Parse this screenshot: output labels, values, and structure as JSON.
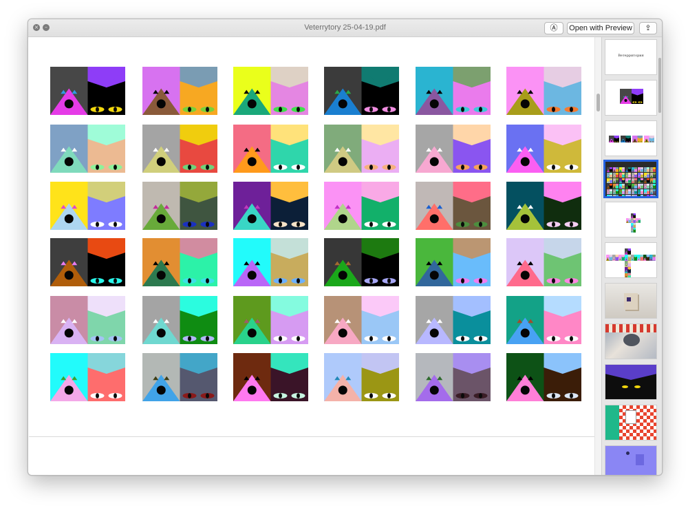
{
  "window": {
    "title": "Veterrytory 25-04-19.pdf",
    "buttons": {
      "markup_label": "Ⓐ",
      "open_with_preview": "Open with Preview",
      "share_label": "⇪"
    },
    "close_glyph": "×",
    "minimize_glyph": "–"
  },
  "sidebar": {
    "cover_text": "Ветерритория",
    "selected_index": 3
  },
  "tiles": [
    [
      "#474747",
      "#8e3df7",
      "#2f9be3",
      "#e53be7",
      "#000000",
      "#f2d70d"
    ],
    [
      "#d772f0",
      "#7a9cb3",
      "#000000",
      "#8a5a3a",
      "#f7a822",
      "#78d13a"
    ],
    [
      "#eaff1b",
      "#ded1c5",
      "#000000",
      "#1aa87a",
      "#e486e2",
      "#3fe04a"
    ],
    [
      "#3b3b3b",
      "#107b71",
      "#2aa94b",
      "#1a7fd0",
      "#000000",
      "#f08ce0"
    ],
    [
      "#2ab4d1",
      "#7ca06f",
      "#000000",
      "#8a57a0",
      "#ea7bec",
      "#3ecbd8"
    ],
    [
      "#fb92f5",
      "#e6cde3",
      "#000000",
      "#a89d1a",
      "#6cb7e1",
      "#f47a2f"
    ],
    [
      "#7fa1c5",
      "#9ffcd8",
      "#ffffff",
      "#7fdabc",
      "#ecba92",
      "#8ef29a"
    ],
    [
      "#a4a4a4",
      "#f0cd0e",
      "#ffffff",
      "#d0cf7c",
      "#e84940",
      "#6fd27a"
    ],
    [
      "#f46c84",
      "#ffe27a",
      "#000000",
      "#ff9a1c",
      "#2fd6ab",
      "#ffffff"
    ],
    [
      "#80ab7b",
      "#ffe6a3",
      "#ffffff",
      "#d0ca83",
      "#ebaef3",
      "#f6b07d"
    ],
    [
      "#a6a6a6",
      "#ffd6a9",
      "#ffffff",
      "#f7a8d1",
      "#8a55f0",
      "#f6a25a"
    ],
    [
      "#6a71f2",
      "#fbc1f5",
      "#ffffff",
      "#fb5ff2",
      "#cfb93a",
      "#ffffff"
    ],
    [
      "#ffe31a",
      "#d2cf7a",
      "#e34cc4",
      "#add6f0",
      "#7e7cff",
      "#ffffff"
    ],
    [
      "#bfb9b0",
      "#94a83b",
      "#c32a9a",
      "#68aa3a",
      "#3f5540",
      "#1a30c0"
    ],
    [
      "#6e2099",
      "#ffbe3d",
      "#c238bd",
      "#39d6c5",
      "#0c1f38",
      "#f6e2c8"
    ],
    [
      "#fb92f5",
      "#f9a9e6",
      "#c22ec6",
      "#b0d58b",
      "#12b06a",
      "#ffffff"
    ],
    [
      "#c0b8b6",
      "#ff6d88",
      "#1a5fd0",
      "#ff6f6a",
      "#6b563e",
      "#4c8e3e"
    ],
    [
      "#045060",
      "#ff82f0",
      "#ffffff",
      "#a5c23a",
      "#102d0e",
      "#f4cef2"
    ],
    [
      "#3e3e3e",
      "#e84a12",
      "#e87bf0",
      "#b05d0a",
      "#000000",
      "#29f6ea"
    ],
    [
      "#e28e32",
      "#d18ca0",
      "#000000",
      "#2c7a4f",
      "#2cf2a8",
      "#3edfe8"
    ],
    [
      "#22fbfb",
      "#c4e0d8",
      "#000000",
      "#b966f7",
      "#c8ac5d",
      "#6cb1ff"
    ],
    [
      "#373737",
      "#1d7a10",
      "#a36a30",
      "#1aa81a",
      "#000000",
      "#a7a7f5"
    ],
    [
      "#4ab73c",
      "#bb9672",
      "#000000",
      "#31679c",
      "#69bcfb",
      "#f07ef0"
    ],
    [
      "#dcc7f8",
      "#c6d6ea",
      "#000000",
      "#ff6a8c",
      "#6ec473",
      "#ff86e2"
    ],
    [
      "#c98ca6",
      "#eee0fa",
      "#ffffff",
      "#d9b2f3",
      "#7fd6ab",
      "#a3c3f4"
    ],
    [
      "#a4a4a4",
      "#2bfcdf",
      "#ffffff",
      "#6fd8d0",
      "#0f8c12",
      "#b1b8f6"
    ],
    [
      "#5e9a1e",
      "#84fbdf",
      "#a05a6a",
      "#29d28b",
      "#d69bf2",
      "#ffffff"
    ],
    [
      "#b79277",
      "#fbc9f8",
      "#ffffff",
      "#f7a8c3",
      "#9ac7f6",
      "#ffffff"
    ],
    [
      "#a6a6a6",
      "#a3bfff",
      "#ffffff",
      "#b8b8ff",
      "#0a8f9c",
      "#ffffff"
    ],
    [
      "#13a287",
      "#b5dcff",
      "#a04d2e",
      "#48a2f3",
      "#ff87c6",
      "#ffffff"
    ],
    [
      "#22fbfb",
      "#86d6db",
      "#3aa32e",
      "#f3a8e8",
      "#fe6d6d",
      "#ffffff"
    ],
    [
      "#b3b8b5",
      "#43a6c8",
      "#3e3e16",
      "#41a3e8",
      "#55586f",
      "#8a1a1a"
    ],
    [
      "#6e2a0f",
      "#34e5bd",
      "#000000",
      "#ff79f0",
      "#3a1428",
      "#c8f5e2"
    ],
    [
      "#afcafb",
      "#c2c5f3",
      "#1f88b7",
      "#f4b2a9",
      "#9b9614",
      "#ffffff"
    ],
    [
      "#b5b8bd",
      "#a88ef0",
      "#2e6a2e",
      "#a46ceb",
      "#6b5468",
      "#3a1d26"
    ],
    [
      "#0d5216",
      "#8bc3fb",
      "#000000",
      "#ff7fd8",
      "#3b1d08",
      "#dce7f5"
    ]
  ]
}
